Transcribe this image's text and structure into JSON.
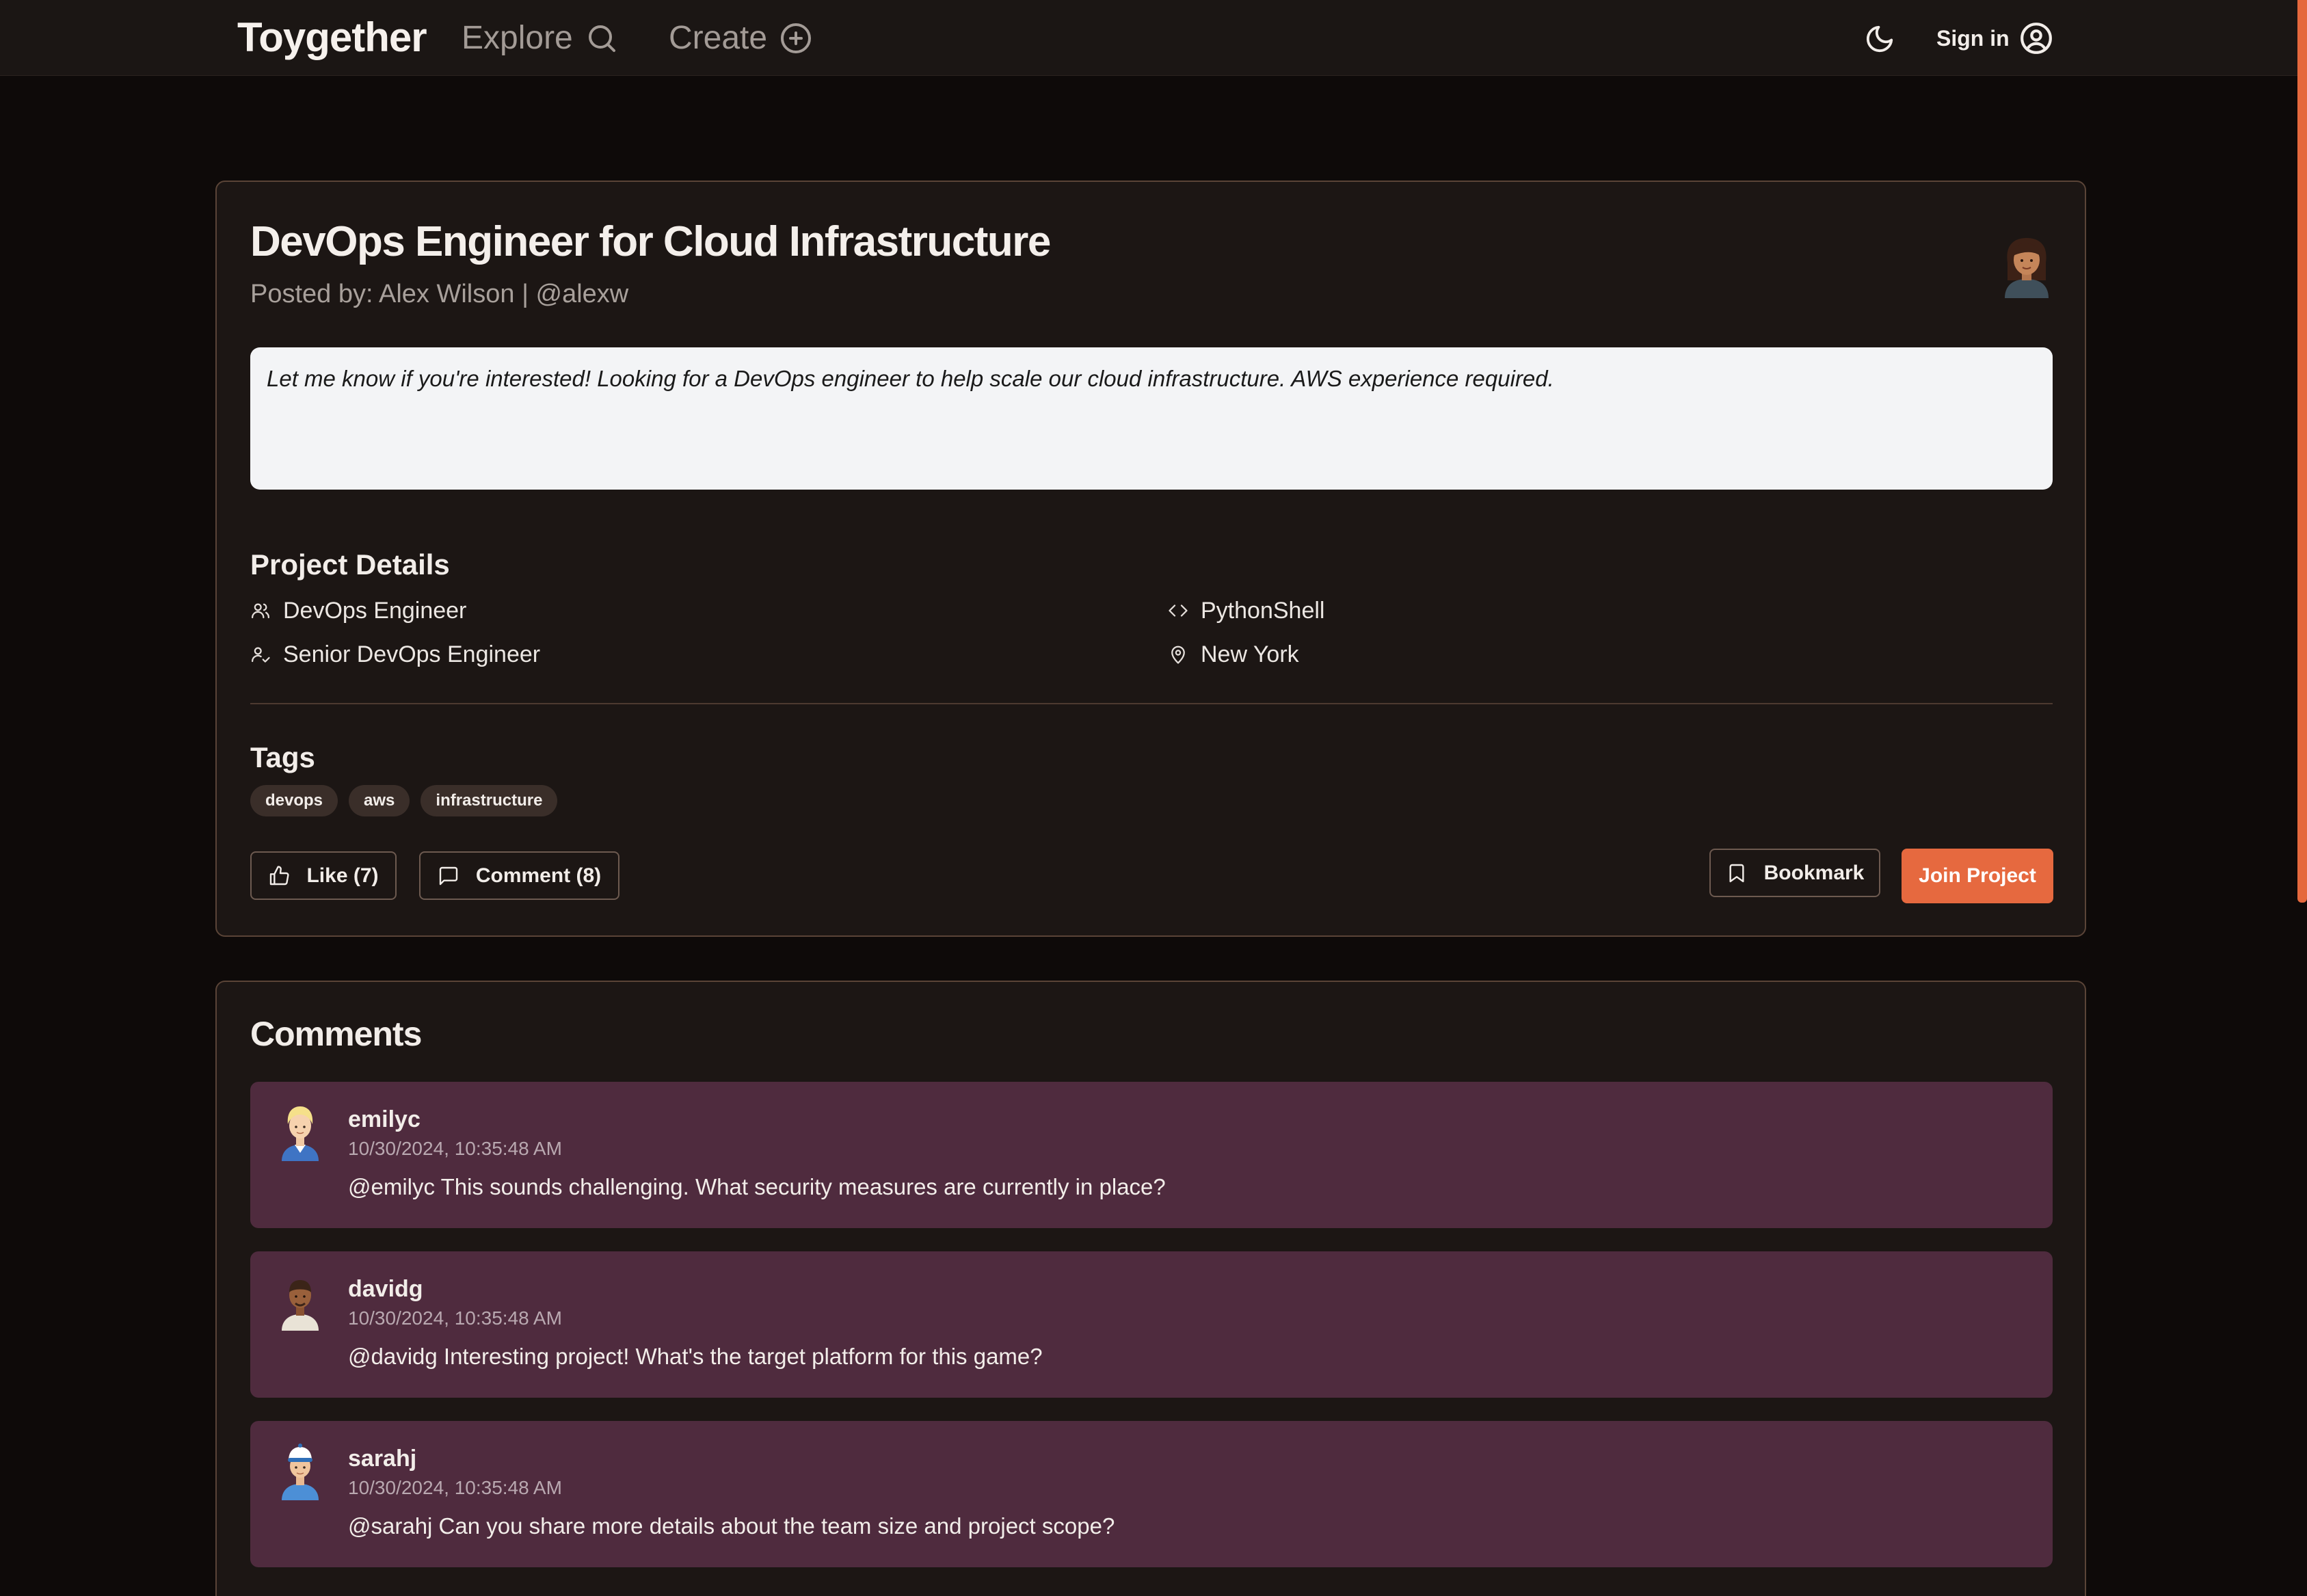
{
  "header": {
    "brand": "Toygether",
    "explore_label": "Explore",
    "create_label": "Create",
    "signin_label": "Sign in"
  },
  "project": {
    "title": "DevOps Engineer for Cloud Infrastructure",
    "posted_by": "Posted by: Alex Wilson | @alexw",
    "description": "Let me know if you're interested! Looking for a DevOps engineer to help scale our cloud infrastructure. AWS experience required.",
    "details_heading": "Project Details",
    "details": {
      "role": "DevOps Engineer",
      "level": "Senior DevOps Engineer",
      "tech": "PythonShell",
      "location": "New York"
    },
    "tags_heading": "Tags",
    "tags": [
      "devops",
      "aws",
      "infrastructure"
    ],
    "actions": {
      "like_label": "Like (7)",
      "comment_label": "Comment (8)",
      "bookmark_label": "Bookmark",
      "join_label": "Join Project"
    }
  },
  "comments": {
    "heading": "Comments",
    "items": [
      {
        "user": "emilyc",
        "time": "10/30/2024, 10:35:48 AM",
        "text": "@emilyc This sounds challenging. What security measures are currently in place?"
      },
      {
        "user": "davidg",
        "time": "10/30/2024, 10:35:48 AM",
        "text": "@davidg Interesting project! What's the target platform for this game?"
      },
      {
        "user": "sarahj",
        "time": "10/30/2024, 10:35:48 AM",
        "text": "@sarahj Can you share more details about the team size and project scope?"
      }
    ]
  },
  "colors": {
    "accent": "#e6693f",
    "page_bg": "#0e0a09",
    "card_bg": "#1c1614",
    "card_border": "#5a4437",
    "comment_bg": "#4f2b3e",
    "description_bg": "#f3f4f6"
  },
  "icons": {
    "explore": "search-icon",
    "create": "plus-circle-icon",
    "theme": "moon-icon",
    "signin": "user-circle-icon",
    "role": "users-icon",
    "level": "user-check-icon",
    "tech": "code-icon",
    "location": "map-pin-icon",
    "like": "thumbs-up-icon",
    "comment": "message-square-icon",
    "bookmark": "bookmark-icon"
  }
}
